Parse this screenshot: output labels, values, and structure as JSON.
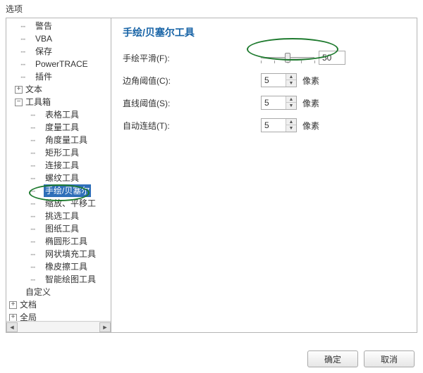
{
  "window": {
    "title": "选项"
  },
  "tree": {
    "items": [
      {
        "indent": 1,
        "tw": "",
        "label": "警告"
      },
      {
        "indent": 1,
        "tw": "",
        "label": "VBA"
      },
      {
        "indent": 1,
        "tw": "",
        "label": "保存"
      },
      {
        "indent": 1,
        "tw": "",
        "label": "PowerTRACE"
      },
      {
        "indent": 1,
        "tw": "",
        "label": "插件"
      },
      {
        "indent": 0,
        "tw": "+",
        "label": "文本"
      },
      {
        "indent": 0,
        "tw": "-",
        "label": "工具箱"
      },
      {
        "indent": 2,
        "tw": "",
        "label": "表格工具"
      },
      {
        "indent": 2,
        "tw": "",
        "label": "度量工具"
      },
      {
        "indent": 2,
        "tw": "",
        "label": "角度量工具"
      },
      {
        "indent": 2,
        "tw": "",
        "label": "矩形工具"
      },
      {
        "indent": 2,
        "tw": "",
        "label": "连接工具"
      },
      {
        "indent": 2,
        "tw": "",
        "label": "螺纹工具"
      },
      {
        "indent": 2,
        "tw": "",
        "label": "手绘/贝塞尔",
        "selected": true
      },
      {
        "indent": 2,
        "tw": "",
        "label": "缩放、平移工"
      },
      {
        "indent": 2,
        "tw": "",
        "label": "挑选工具"
      },
      {
        "indent": 2,
        "tw": "",
        "label": "图纸工具"
      },
      {
        "indent": 2,
        "tw": "",
        "label": "椭圆形工具"
      },
      {
        "indent": 2,
        "tw": "",
        "label": "网状填充工具"
      },
      {
        "indent": 2,
        "tw": "",
        "label": "橡皮擦工具"
      },
      {
        "indent": 2,
        "tw": "",
        "label": "智能绘图工具"
      },
      {
        "indent": 0,
        "tw": "",
        "label": "自定义"
      },
      {
        "indent": -1,
        "tw": "+",
        "label": "文档"
      },
      {
        "indent": -1,
        "tw": "+",
        "label": "全局"
      }
    ]
  },
  "panel": {
    "title": "手绘/贝塞尔工具",
    "rows": {
      "smooth": {
        "label": "手绘平滑(F):",
        "value": "50"
      },
      "corner": {
        "label": "边角阈值(C):",
        "value": "5",
        "unit": "像素"
      },
      "line": {
        "label": "直线阈值(S):",
        "value": "5",
        "unit": "像素"
      },
      "autojoin": {
        "label": "自动连结(T):",
        "value": "5",
        "unit": "像素"
      }
    }
  },
  "footer": {
    "ok": "确定",
    "cancel": "取消"
  }
}
